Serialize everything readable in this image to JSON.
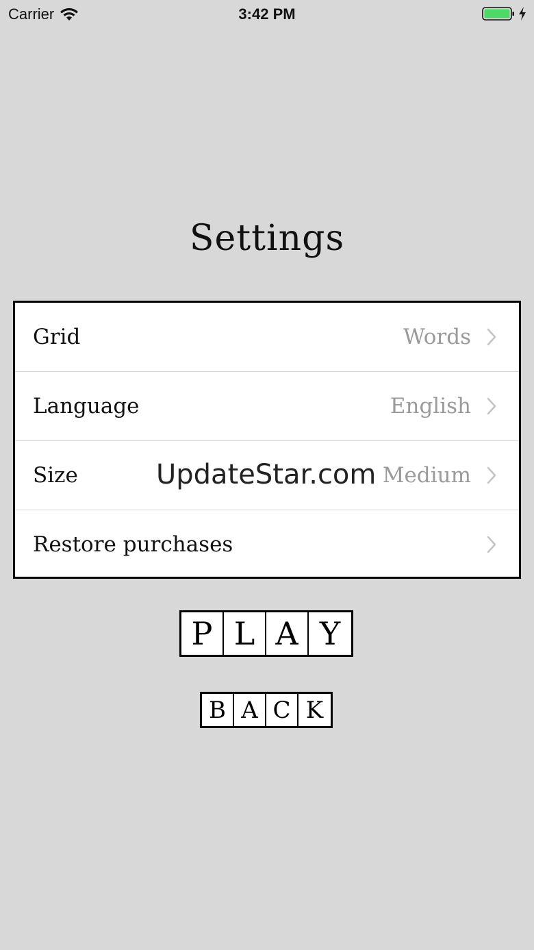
{
  "status_bar": {
    "carrier": "Carrier",
    "time": "3:42 PM",
    "battery_color": "#4cd964"
  },
  "title": "Settings",
  "settings": [
    {
      "label": "Grid",
      "value": "Words",
      "icon": "chevron-right-icon"
    },
    {
      "label": "Language",
      "value": "English",
      "icon": "chevron-right-icon"
    },
    {
      "label": "Size",
      "value": "Medium",
      "icon": "chevron-right-icon"
    },
    {
      "label": "Restore purchases",
      "value": "",
      "icon": "chevron-right-icon"
    }
  ],
  "watermark": "UpdateStar.com",
  "play_button": {
    "letters": [
      "P",
      "L",
      "A",
      "Y"
    ]
  },
  "back_button": {
    "letters": [
      "B",
      "A",
      "C",
      "K"
    ]
  },
  "colors": {
    "background": "#d8d8d8",
    "value_text": "#9a9a9a",
    "chevron": "#c4c4c4"
  }
}
